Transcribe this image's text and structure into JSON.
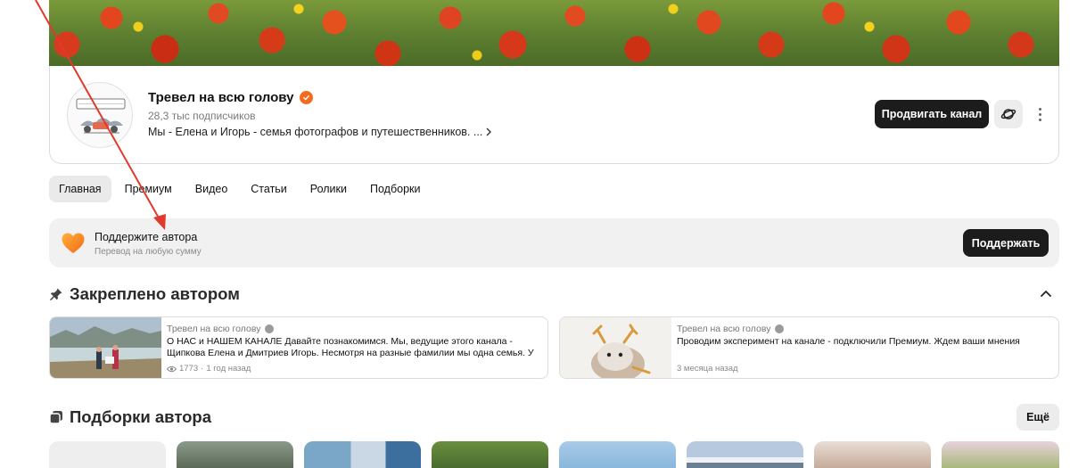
{
  "channel": {
    "name": "Тревел на всю голову",
    "subscribers": "28,3 тыс подписчиков",
    "description": "Мы - Елена и Игорь - семья фотографов и путешественников. ...",
    "avatar_text": "Тревел на всю голову",
    "promote_label": "Продвигать канал",
    "accent_color": "#f36b1f"
  },
  "tabs": [
    {
      "label": "Главная",
      "active": true
    },
    {
      "label": "Премиум",
      "active": false
    },
    {
      "label": "Видео",
      "active": false
    },
    {
      "label": "Статьи",
      "active": false
    },
    {
      "label": "Ролики",
      "active": false
    },
    {
      "label": "Подборки",
      "active": false
    }
  ],
  "support": {
    "title": "Поддержите автора",
    "subtitle": "Перевод на любую сумму",
    "button_label": "Поддержать"
  },
  "pinned": {
    "title": "Закреплено автором",
    "cards": [
      {
        "author": "Тревел на всю голову",
        "text": "О НАС и НАШЕМ КАНАЛЕ Давайте познакомимся. Мы, ведущие этого канала - Щипкова Елена и Дмитриев Игорь. Несмотря на разные фамилии мы одна семья. У нас два кана...",
        "views": "1773",
        "time": "1 год назад"
      },
      {
        "author": "Тревел на всю голову",
        "text": "Проводим эксперимент на канале - подключили Премиум. Ждем ваши мнения",
        "time": "3 месяца назад"
      }
    ]
  },
  "collections": {
    "title": "Подборки автора",
    "more_label": "Ещё"
  },
  "icons": {
    "verified": "checkmark-badge-icon",
    "orbit": "planet-icon",
    "more": "kebab-icon",
    "pin": "pin-icon",
    "collections": "stack-icon",
    "heart": "heart-icon",
    "eye": "eye-icon",
    "chevron_up": "chevron-up-icon"
  }
}
